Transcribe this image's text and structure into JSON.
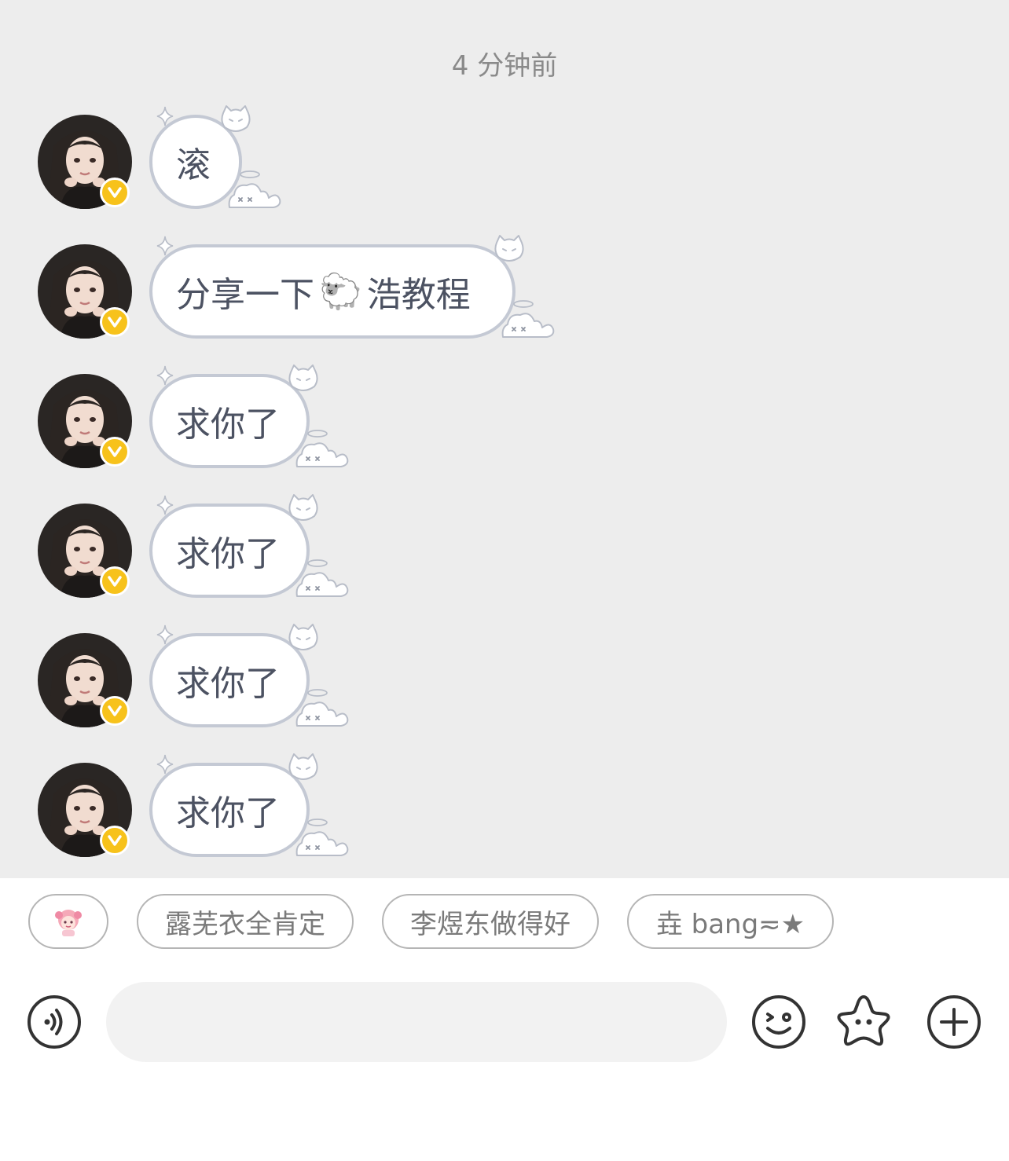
{
  "chat": {
    "timestamp": "4 分钟前",
    "messages": [
      {
        "text_before": "滚",
        "emoji": "",
        "text_after": ""
      },
      {
        "text_before": "分享一下",
        "emoji": "🐑",
        "text_after": "浩教程"
      },
      {
        "text_before": "求你了",
        "emoji": "",
        "text_after": ""
      },
      {
        "text_before": "求你了",
        "emoji": "",
        "text_after": ""
      },
      {
        "text_before": "求你了",
        "emoji": "",
        "text_after": ""
      },
      {
        "text_before": "求你了",
        "emoji": "",
        "text_after": ""
      }
    ]
  },
  "quick_replies": {
    "sticker_icon": "anime-sticker-icon",
    "chips": [
      "露芜衣全肯定",
      "李煜东做得好",
      "垚 bang≂★"
    ]
  },
  "input": {
    "placeholder": "",
    "value": ""
  },
  "icons": {
    "voice": "voice-icon",
    "emoji": "emoji-icon",
    "sticker": "star-sticker-icon",
    "more": "plus-icon"
  },
  "colors": {
    "chat_background": "#ededed",
    "bubble_border": "#c4c9d4",
    "bubble_text": "#4c5262",
    "verified_badge": "#f7c21b",
    "icon_stroke": "#333333"
  }
}
